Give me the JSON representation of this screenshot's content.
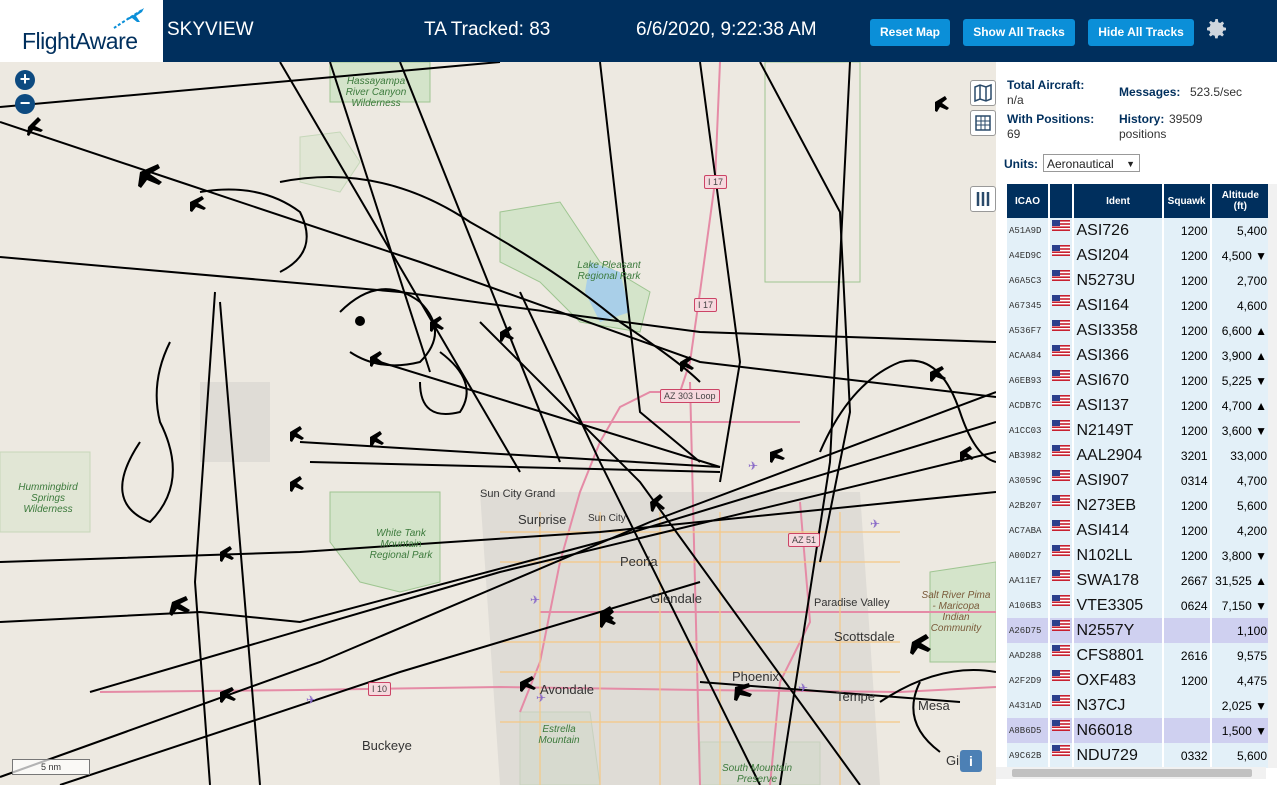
{
  "header": {
    "logo": "FlightAware",
    "app_name": "SKYVIEW",
    "tracked": "TA Tracked: 83",
    "datetime": "6/6/2020, 9:22:38 AM",
    "reset_label": "Reset Map",
    "show_label": "Show All Tracks",
    "hide_label": "Hide All Tracks",
    "brand_color": "#002f5d",
    "button_color": "#0b8fd8"
  },
  "map": {
    "labels": {
      "hassayampa": "Hassayampa River Canyon Wilderness",
      "lake_pleasant": "Lake Pleasant Regional Park",
      "hummingbird": "Hummingbird Springs Wilderness",
      "white_tank": "White Tank Mountain Regional Park",
      "salt_river": "Salt River Pima - Maricopa Indian Community",
      "estrella": "Estrella Mountain",
      "south_mountain": "South Mountain Preserve"
    },
    "cities": {
      "sun_city_grand": "Sun City Grand",
      "surprise": "Surprise",
      "sun_city": "Sun City",
      "peoria": "Peoria",
      "glendale": "Glendale",
      "paradise_valley": "Paradise Valley",
      "scottsdale": "Scottsdale",
      "phoenix": "Phoenix",
      "tempe": "Tempe",
      "mesa": "Mesa",
      "buckeye": "Buckeye",
      "avondale": "Avondale",
      "gilbert": "Gilb"
    },
    "highways": {
      "i17_north": "I 17",
      "i17": "I 17",
      "loop303": "AZ 303 Loop",
      "az51": "AZ 51",
      "i10": "I 10"
    },
    "scale": "5 nm",
    "zoom_in": "+",
    "zoom_out": "−",
    "info": "i"
  },
  "panel": {
    "total_aircraft_label": "Total Aircraft:",
    "total_aircraft_value": "n/a",
    "with_positions_label": "With Positions:",
    "with_positions_value": "69",
    "messages_label": "Messages:",
    "messages_value": "523.5/sec",
    "history_label": "History:",
    "history_value": "39509",
    "history_unit": "positions",
    "units_label": "Units:",
    "units_value": "Aeronautical",
    "columns": {
      "icao": "ICAO",
      "ident": "Ident",
      "squawk": "Squawk",
      "altitude": "Altitude",
      "altitude_unit": "(ft)"
    },
    "rows": [
      {
        "icao": "A51A9D",
        "ident": "ASI726",
        "squawk": "1200",
        "alt": "5,400"
      },
      {
        "icao": "A4ED9C",
        "ident": "ASI204",
        "squawk": "1200",
        "alt": "4,500 ▼"
      },
      {
        "icao": "A6A5C3",
        "ident": "N5273U",
        "squawk": "1200",
        "alt": "2,700"
      },
      {
        "icao": "A67345",
        "ident": "ASI164",
        "squawk": "1200",
        "alt": "4,600"
      },
      {
        "icao": "A536F7",
        "ident": "ASI3358",
        "squawk": "1200",
        "alt": "6,600 ▲"
      },
      {
        "icao": "ACAA84",
        "ident": "ASI366",
        "squawk": "1200",
        "alt": "3,900 ▲"
      },
      {
        "icao": "A6EB93",
        "ident": "ASI670",
        "squawk": "1200",
        "alt": "5,225 ▼"
      },
      {
        "icao": "ACDB7C",
        "ident": "ASI137",
        "squawk": "1200",
        "alt": "4,700 ▲"
      },
      {
        "icao": "A1CC03",
        "ident": "N2149T",
        "squawk": "1200",
        "alt": "3,600 ▼"
      },
      {
        "icao": "AB3982",
        "ident": "AAL2904",
        "squawk": "3201",
        "alt": "33,000"
      },
      {
        "icao": "A3059C",
        "ident": "ASI907",
        "squawk": "0314",
        "alt": "4,700"
      },
      {
        "icao": "A2B207",
        "ident": "N273EB",
        "squawk": "1200",
        "alt": "5,600"
      },
      {
        "icao": "AC7ABA",
        "ident": "ASI414",
        "squawk": "1200",
        "alt": "4,200"
      },
      {
        "icao": "A00D27",
        "ident": "N102LL",
        "squawk": "1200",
        "alt": "3,800 ▼"
      },
      {
        "icao": "AA11E7",
        "ident": "SWA178",
        "squawk": "2667",
        "alt": "31,525 ▲"
      },
      {
        "icao": "A106B3",
        "ident": "VTE3305",
        "squawk": "0624",
        "alt": "7,150 ▼"
      },
      {
        "icao": "A26D75",
        "ident": "N2557Y",
        "squawk": "",
        "alt": "1,100"
      },
      {
        "icao": "AAD288",
        "ident": "CFS8801",
        "squawk": "2616",
        "alt": "9,575"
      },
      {
        "icao": "A2F2D9",
        "ident": "OXF483",
        "squawk": "1200",
        "alt": "4,475"
      },
      {
        "icao": "A431AD",
        "ident": "N37CJ",
        "squawk": "",
        "alt": "2,025 ▼"
      },
      {
        "icao": "A8B6D5",
        "ident": "N66018",
        "squawk": "",
        "alt": "1,500 ▼"
      },
      {
        "icao": "A9C62B",
        "ident": "NDU729",
        "squawk": "0332",
        "alt": "5,600"
      }
    ],
    "selected_rows": [
      16,
      20
    ]
  }
}
